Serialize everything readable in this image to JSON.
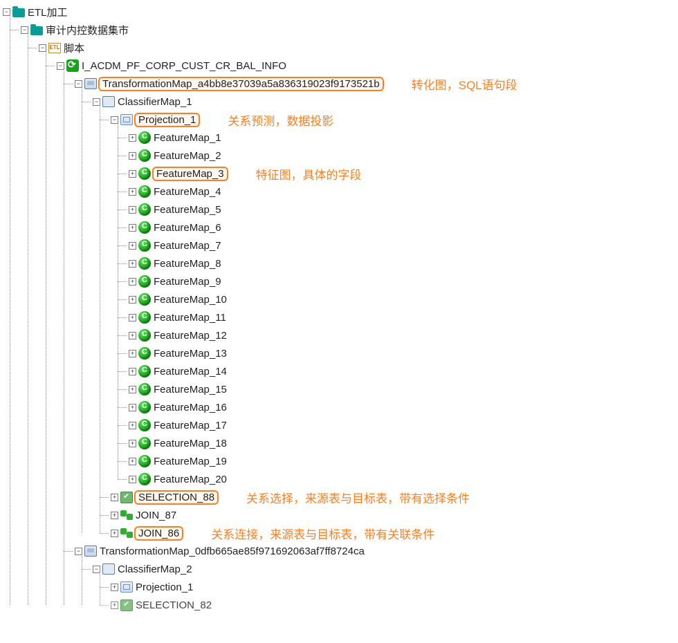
{
  "root": {
    "label": "ETL加工",
    "child": {
      "label": "审计内控数据集市",
      "child": {
        "label": "脚本",
        "child": {
          "label": "I_ACDM_PF_CORP_CUST_CR_BAL_INFO",
          "tmap1": {
            "label": "TransformationMap_a4bb8e37039a5a836319023f9173521b",
            "annot": "转化图，SQL语句段",
            "classifier": {
              "label": "ClassifierMap_1",
              "projection": {
                "label": "Projection_1",
                "annot": "关系预测，数据投影",
                "feature_annot": "特征图，具体的字段",
                "features": [
                  "FeatureMap_1",
                  "FeatureMap_2",
                  "FeatureMap_3",
                  "FeatureMap_4",
                  "FeatureMap_5",
                  "FeatureMap_6",
                  "FeatureMap_7",
                  "FeatureMap_8",
                  "FeatureMap_9",
                  "FeatureMap_10",
                  "FeatureMap_11",
                  "FeatureMap_12",
                  "FeatureMap_13",
                  "FeatureMap_14",
                  "FeatureMap_15",
                  "FeatureMap_16",
                  "FeatureMap_17",
                  "FeatureMap_18",
                  "FeatureMap_19",
                  "FeatureMap_20"
                ]
              },
              "selection": {
                "label": "SELECTION_88",
                "annot": "关系选择，来源表与目标表，带有选择条件"
              },
              "join87": {
                "label": "JOIN_87"
              },
              "join86": {
                "label": "JOIN_86",
                "annot": "关系连接，来源表与目标表，带有关联条件"
              }
            }
          },
          "tmap2": {
            "label": "TransformationMap_0dfb665ae85f971692063af7ff8724ca",
            "classifier": {
              "label": "ClassifierMap_2",
              "projection": {
                "label": "Projection_1"
              },
              "selection": {
                "label": "SELECTION_82"
              }
            }
          }
        }
      }
    }
  },
  "etl_icon_text": "ETL"
}
